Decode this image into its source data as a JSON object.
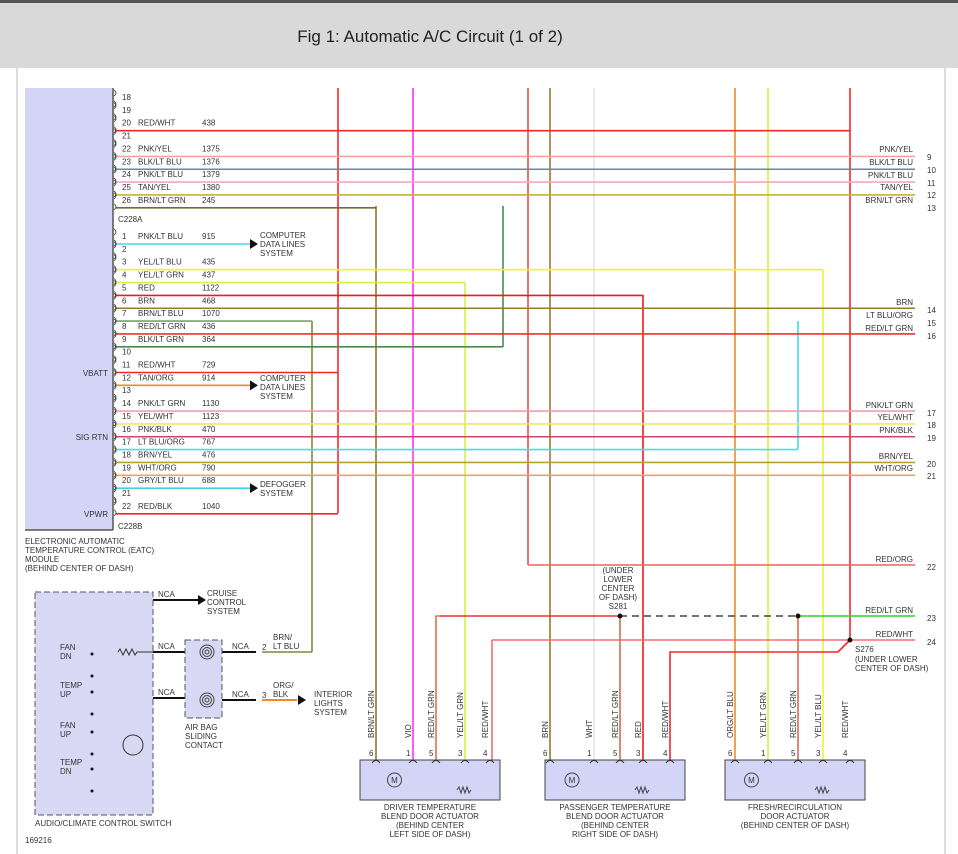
{
  "header": {
    "title": "Fig 1: Automatic A/C Circuit (1 of 2)"
  },
  "module": {
    "name_lines": [
      "ELECTRONIC AUTOMATIC",
      "TEMPERATURE CONTROL (EATC)",
      "MODULE",
      "(BEHIND CENTER OF DASH)"
    ],
    "connector_a": "C228A",
    "connector_b": "C228B",
    "side_labels": {
      "vbatt": "VBATT",
      "sig_rtn": "SIG RTN",
      "vpwr": "VPWR"
    },
    "rows_top": [
      {
        "pin": "18",
        "color": "",
        "circuit": "",
        "wire": ""
      },
      {
        "pin": "19",
        "color": "",
        "circuit": "",
        "wire": ""
      },
      {
        "pin": "20",
        "color": "RED/WHT",
        "circuit": "438",
        "wire": "#f02828"
      },
      {
        "pin": "21",
        "color": "",
        "circuit": "",
        "wire": ""
      },
      {
        "pin": "22",
        "color": "PNK/YEL",
        "circuit": "1375",
        "wire": "#f7a0a0"
      },
      {
        "pin": "23",
        "color": "BLK/LT BLU",
        "circuit": "1376",
        "wire": "#6a8a9a"
      },
      {
        "pin": "24",
        "color": "PNK/LT BLU",
        "circuit": "1379",
        "wire": "#f3a7c6"
      },
      {
        "pin": "25",
        "color": "TAN/YEL",
        "circuit": "1380",
        "wire": "#c8b030"
      },
      {
        "pin": "26",
        "color": "BRN/LT GRN",
        "circuit": "245",
        "wire": "#7a6a2a"
      }
    ],
    "rows_bottom": [
      {
        "pin": "1",
        "color": "PNK/LT BLU",
        "circuit": "915",
        "wire": "#40d8f0"
      },
      {
        "pin": "2",
        "color": "",
        "circuit": "",
        "wire": ""
      },
      {
        "pin": "3",
        "color": "YEL/LT BLU",
        "circuit": "435",
        "wire": "#f0f040"
      },
      {
        "pin": "4",
        "color": "YEL/LT GRN",
        "circuit": "437",
        "wire": "#d8f040"
      },
      {
        "pin": "5",
        "color": "RED",
        "circuit": "1122",
        "wire": "#f01818"
      },
      {
        "pin": "6",
        "color": "BRN",
        "circuit": "468",
        "wire": "#9a7a30"
      },
      {
        "pin": "7",
        "color": "BRN/LT BLU",
        "circuit": "1070",
        "wire": "#7aa070"
      },
      {
        "pin": "8",
        "color": "RED/LT GRN",
        "circuit": "436",
        "wire": "#f03030"
      },
      {
        "pin": "9",
        "color": "BLK/LT GRN",
        "circuit": "364",
        "wire": "#4a8a4a"
      },
      {
        "pin": "10",
        "color": "",
        "circuit": "",
        "wire": ""
      },
      {
        "pin": "11",
        "color": "RED/WHT",
        "circuit": "729",
        "wire": "#f02828"
      },
      {
        "pin": "12",
        "color": "TAN/ORG",
        "circuit": "914",
        "wire": "#f08a20"
      },
      {
        "pin": "13",
        "color": "",
        "circuit": "",
        "wire": ""
      },
      {
        "pin": "14",
        "color": "PNK/LT GRN",
        "circuit": "1130",
        "wire": "#f0a0a8"
      },
      {
        "pin": "15",
        "color": "YEL/WHT",
        "circuit": "1123",
        "wire": "#f0e860"
      },
      {
        "pin": "16",
        "color": "PNK/BLK",
        "circuit": "470",
        "wire": "#d04070"
      },
      {
        "pin": "17",
        "color": "LT BLU/ORG",
        "circuit": "767",
        "wire": "#40e0e8"
      },
      {
        "pin": "18",
        "color": "BRN/YEL",
        "circuit": "476",
        "wire": "#b8a030"
      },
      {
        "pin": "19",
        "color": "WHT/ORG",
        "circuit": "790",
        "wire": "#f0a060"
      },
      {
        "pin": "20",
        "color": "GRY/LT BLU",
        "circuit": "688",
        "wire": "#40d0e8"
      },
      {
        "pin": "21",
        "color": "",
        "circuit": "",
        "wire": ""
      },
      {
        "pin": "22",
        "color": "RED/BLK",
        "circuit": "1040",
        "wire": "#f02828"
      }
    ]
  },
  "destinations": {
    "computer_data_lines": [
      "COMPUTER",
      "DATA LINES",
      "SYSTEM"
    ],
    "defogger": [
      "DEFOGGER",
      "SYSTEM"
    ],
    "cruise": [
      "CRUISE",
      "CONTROL",
      "SYSTEM"
    ],
    "interior_lights": [
      "INTERIOR",
      "LIGHTS",
      "SYSTEM"
    ]
  },
  "right_connectors": [
    {
      "num": "9",
      "label": "PNK/YEL"
    },
    {
      "num": "10",
      "label": "BLK/LT BLU"
    },
    {
      "num": "11",
      "label": "PNK/LT BLU"
    },
    {
      "num": "12",
      "label": "TAN/YEL"
    },
    {
      "num": "13",
      "label": "BRN/LT GRN"
    },
    {
      "num": "14",
      "label": "BRN"
    },
    {
      "num": "15",
      "label": "LT BLU/ORG"
    },
    {
      "num": "16",
      "label": "RED/LT GRN"
    },
    {
      "num": "17",
      "label": "PNK/LT GRN"
    },
    {
      "num": "18",
      "label": "YEL/WHT"
    },
    {
      "num": "19",
      "label": "PNK/BLK"
    },
    {
      "num": "20",
      "label": "BRN/YEL"
    },
    {
      "num": "21",
      "label": "WHT/ORG"
    },
    {
      "num": "22",
      "label": "RED/ORG"
    },
    {
      "num": "23",
      "label": "RED/LT GRN"
    },
    {
      "num": "24",
      "label": "RED/WHT"
    }
  ],
  "splices": {
    "s281": {
      "id": "S281",
      "location": [
        "(UNDER",
        "LOWER",
        "CENTER",
        "OF DASH)"
      ]
    },
    "s276": {
      "id": "S276",
      "location": [
        "(UNDER LOWER",
        "CENTER OF DASH)"
      ]
    }
  },
  "actuators": [
    {
      "name": [
        "DRIVER TEMPERATURE",
        "BLEND DOOR ACTUATOR",
        "(BEHIND CENTER",
        "LEFT SIDE OF DASH)"
      ],
      "pins": [
        {
          "pin": "6",
          "wire": "BRN/LT GRN"
        },
        {
          "pin": "1",
          "wire": "VIO"
        },
        {
          "pin": "5",
          "wire": "RED/LT GRN"
        },
        {
          "pin": "3",
          "wire": "YEL/LT GRN"
        },
        {
          "pin": "4",
          "wire": "RED/WHT"
        }
      ]
    },
    {
      "name": [
        "PASSENGER TEMPERATURE",
        "BLEND DOOR ACTUATOR",
        "(BEHIND CENTER",
        "RIGHT SIDE OF DASH)"
      ],
      "pins": [
        {
          "pin": "6",
          "wire": "BRN"
        },
        {
          "pin": "1",
          "wire": "WHT"
        },
        {
          "pin": "5",
          "wire": "RED/LT GRN"
        },
        {
          "pin": "3",
          "wire": "RED"
        },
        {
          "pin": "4",
          "wire": "RED/WHT"
        }
      ]
    },
    {
      "name": [
        "FRESH/RECIRCULATION",
        "DOOR ACTUATOR",
        "(BEHIND CENTER OF DASH)"
      ],
      "pins": [
        {
          "pin": "6",
          "wire": "ORG/LT BLU"
        },
        {
          "pin": "1",
          "wire": "YEL/LT GRN"
        },
        {
          "pin": "5",
          "wire": "RED/LT GRN"
        },
        {
          "pin": "3",
          "wire": "YEL/LT BLU"
        },
        {
          "pin": "4",
          "wire": "RED/WHT"
        }
      ]
    }
  ],
  "motor_label": "M",
  "switch": {
    "name": "AUDIO/CLIMATE CONTROL SWITCH",
    "buttons": [
      [
        "FAN",
        "DN"
      ],
      [
        "TEMP",
        "UP"
      ],
      [
        "FAN",
        "UP"
      ],
      [
        "TEMP",
        "DN"
      ]
    ],
    "nca": "NCA"
  },
  "clockspring": {
    "name": [
      "AIR BAG",
      "SLIDING",
      "CONTACT"
    ],
    "nca": "NCA",
    "pin2": "2",
    "pin2_wire": [
      "BRN/",
      "LT BLU"
    ],
    "pin3": "3",
    "pin3_wire": [
      "ORG/",
      "BLK"
    ]
  },
  "figure_id": "169216"
}
